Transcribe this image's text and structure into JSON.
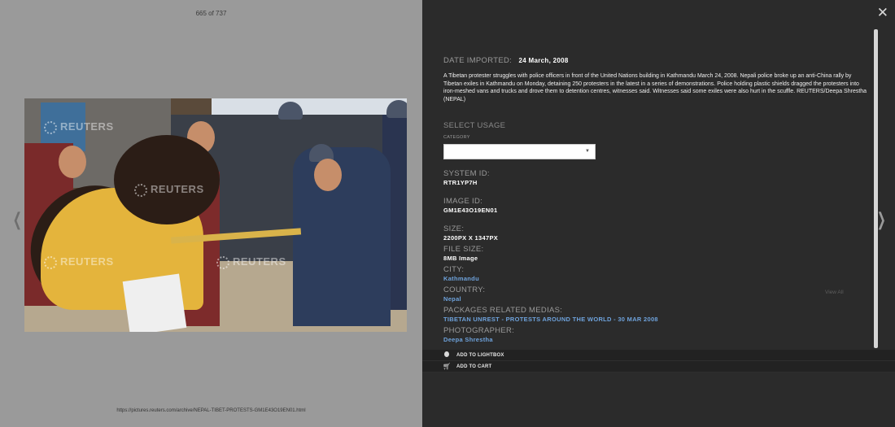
{
  "viewer": {
    "counter": "665 of 737",
    "url": "https://pictures.reuters.com/archive/NEPAL-TIBET-PROTESTS-GM1E43O19EN01.html",
    "watermark": "REUTERS",
    "prev_icon": "chevron-left-icon"
  },
  "panel": {
    "close_icon": "close-icon",
    "next_icon": "chevron-right-icon",
    "date_label": "DATE IMPORTED:",
    "date_value": "24 March, 2008",
    "caption": "A Tibetan protester struggles with police officers in front of the United Nations building in Kathmandu March 24, 2008. Nepali police broke up an anti-China rally by Tibetan exiles in Kathmandu on Monday, detaining 250 protesters in the latest in a series of demonstrations. Police holding plastic shields dragged the protesters into iron-meshed vans and trucks and drove them to detention centres, witnesses said. Witnesses said some exiles were also hurt in the scuffle. REUTERS/Deepa Shrestha (NEPAL)",
    "usage_title": "SELECT USAGE",
    "category_label": "CATEGORY",
    "category_value": "",
    "system_id_label": "SYSTEM ID:",
    "system_id": "RTR1YP7H",
    "image_id_label": "IMAGE ID:",
    "image_id": "GM1E43O19EN01",
    "size_label": "SIZE:",
    "size": "2200PX X 1347PX",
    "file_size_label": "FILE SIZE:",
    "file_size": "8MB Image",
    "city_label": "CITY:",
    "city": "Kathmandu",
    "country_label": "COUNTRY:",
    "country": "Nepal",
    "packages_label": "PACKAGES RELATED MEDIAS:",
    "package_link": "TIBETAN UNREST - PROTESTS AROUND THE WORLD - 30 MAR 2008",
    "view_all": "View All",
    "photographer_label": "PHOTOGRAPHER:",
    "photographer": "Deepa Shrestha"
  },
  "actions": {
    "lightbox": "ADD TO LIGHTBOX",
    "cart": "ADD TO CART"
  }
}
